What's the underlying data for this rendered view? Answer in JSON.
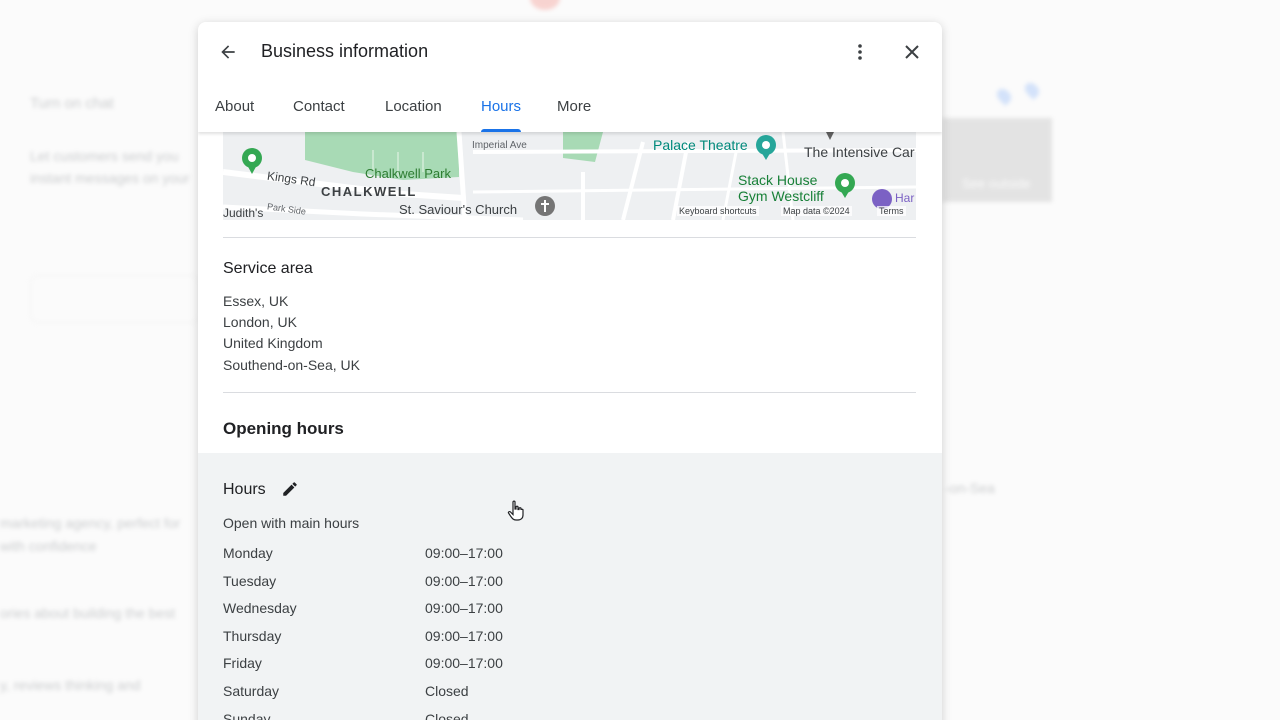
{
  "background": {
    "left_title": "Turn on chat",
    "left_desc_1": "Let customers send you",
    "left_desc_2": "instant messages on your",
    "photos_overlay": "See outside",
    "snippets": [
      "marketing agency, perfect for",
      "with confidence",
      "ories about building the best",
      "y, reviews thinking and",
      "-on-Sea"
    ]
  },
  "dialog": {
    "title": "Business information",
    "tabs": [
      {
        "label": "About",
        "active": false
      },
      {
        "label": "Contact",
        "active": false
      },
      {
        "label": "Location",
        "active": false
      },
      {
        "label": "Hours",
        "active": true
      },
      {
        "label": "More",
        "active": false
      }
    ],
    "icons": {
      "back": "arrow-back-icon",
      "more": "more-vert-icon",
      "close": "close-icon"
    }
  },
  "map": {
    "labels": {
      "imperial": "Imperial Ave",
      "palace": "Palace Theatre",
      "intensive": "The Intensive Car",
      "kings": "Kings Rd",
      "chalkwell_park": "Chalkwell Park",
      "chalkwell": "CHALKWELL",
      "stack1": "Stack House",
      "stack2": "Gym Westcliff",
      "saviour": "St. Saviour's Church",
      "judith": "Judith's",
      "park_side": "Park Side",
      "har": "Har",
      "shortcuts": "Keyboard shortcuts",
      "mapdata": "Map data ©2024",
      "terms": "Terms"
    }
  },
  "service_area": {
    "title": "Service area",
    "areas": [
      "Essex, UK",
      "London, UK",
      "United Kingdom",
      "Southend-on-Sea, UK"
    ]
  },
  "opening_hours": {
    "title": "Opening hours",
    "hours_label": "Hours",
    "subtitle": "Open with main hours",
    "days": [
      {
        "day": "Monday",
        "time": "09:00–17:00"
      },
      {
        "day": "Tuesday",
        "time": "09:00–17:00"
      },
      {
        "day": "Wednesday",
        "time": "09:00–17:00"
      },
      {
        "day": "Thursday",
        "time": "09:00–17:00"
      },
      {
        "day": "Friday",
        "time": "09:00–17:00"
      },
      {
        "day": "Saturday",
        "time": "Closed"
      },
      {
        "day": "Sunday",
        "time": "Closed"
      }
    ]
  },
  "colors": {
    "accent": "#1a73e8",
    "map_park": "#a8dab5",
    "map_pin_green": "#34a853"
  }
}
